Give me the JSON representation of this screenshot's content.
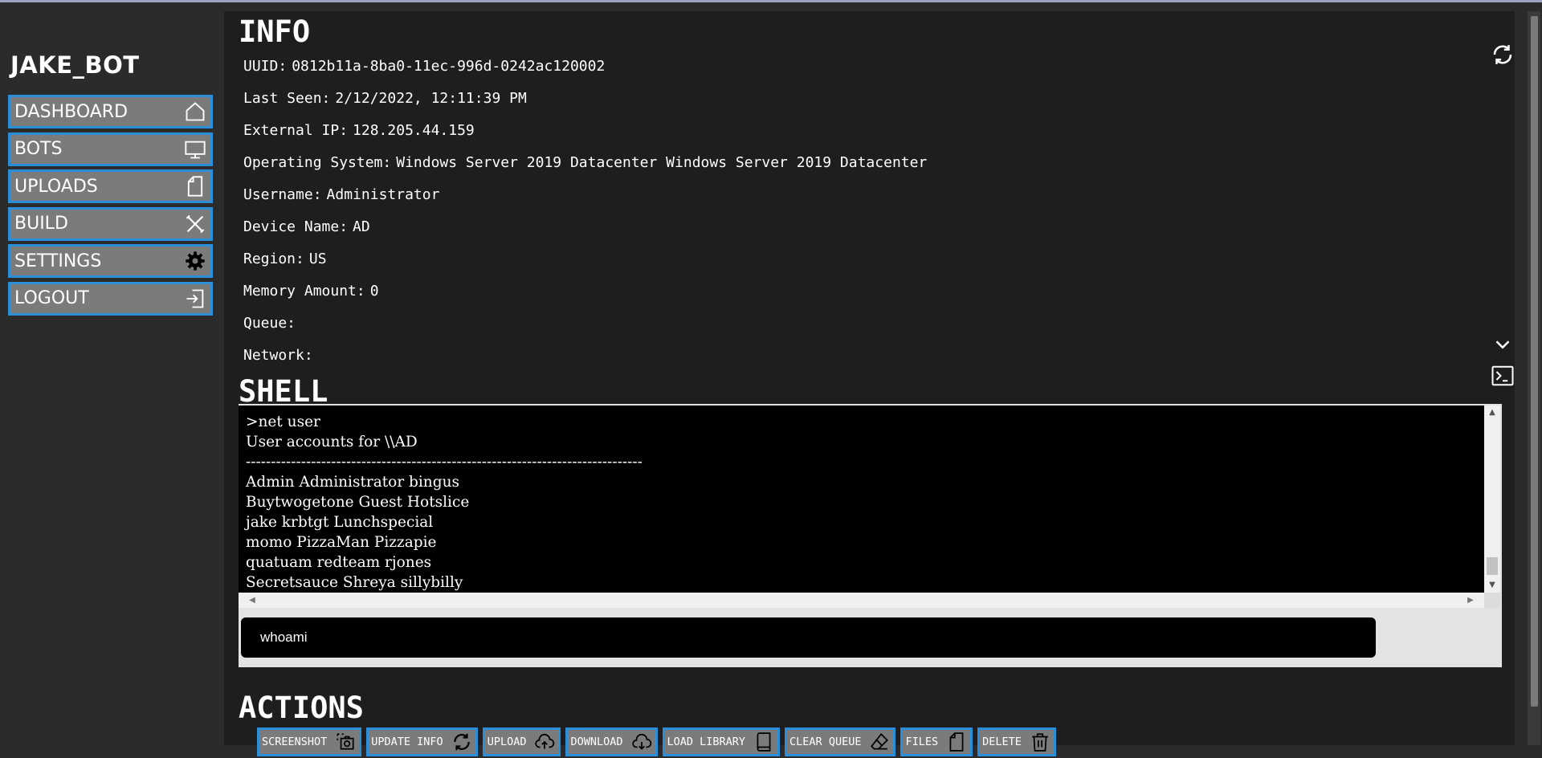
{
  "sidebar": {
    "brand": "JAKE_BOT",
    "items": [
      {
        "label": "DASHBOARD",
        "icon": "home-icon"
      },
      {
        "label": "BOTS",
        "icon": "monitor-icon"
      },
      {
        "label": "UPLOADS",
        "icon": "file-icon"
      },
      {
        "label": "BUILD",
        "icon": "tools-icon"
      },
      {
        "label": "SETTINGS",
        "icon": "gear-icon"
      },
      {
        "label": "LOGOUT",
        "icon": "logout-icon"
      }
    ]
  },
  "info": {
    "title": "INFO",
    "rows": [
      {
        "key": "UUID:",
        "value": "0812b11a-8ba0-11ec-996d-0242ac120002"
      },
      {
        "key": "Last Seen:",
        "value": "2/12/2022, 12:11:39 PM"
      },
      {
        "key": "External IP:",
        "value": "128.205.44.159"
      },
      {
        "key": "Operating System:",
        "value": "Windows Server 2019 Datacenter Windows Server 2019 Datacenter"
      },
      {
        "key": "Username:",
        "value": "Administrator"
      },
      {
        "key": "Device Name:",
        "value": "AD"
      },
      {
        "key": "Region:",
        "value": "US"
      },
      {
        "key": "Memory Amount:",
        "value": "0"
      },
      {
        "key": "Queue:",
        "value": ""
      },
      {
        "key": "Network:",
        "value": ""
      }
    ]
  },
  "shell": {
    "title": "SHELL",
    "lines": [
      ">net user",
      "User accounts for \\\\AD",
      "-------------------------------------------------------------------------------",
      "Admin Administrator bingus",
      "Buytwogetone Guest Hotslice",
      "jake krbtgt Lunchspecial",
      "momo PizzaMan Pizzapie",
      "quatuam redteam rjones",
      "Secretsauce Shreya sillybilly"
    ],
    "input_value": "whoami"
  },
  "actions": {
    "title": "ACTIONS",
    "buttons": [
      {
        "label": "SCREENSHOT",
        "icon": "screenshot-icon"
      },
      {
        "label": "UPDATE INFO",
        "icon": "refresh-icon"
      },
      {
        "label": "UPLOAD",
        "icon": "cloud-upload-icon"
      },
      {
        "label": "DOWNLOAD",
        "icon": "cloud-download-icon"
      },
      {
        "label": "LOAD LIBRARY",
        "icon": "book-icon"
      },
      {
        "label": "CLEAR QUEUE",
        "icon": "eraser-icon"
      },
      {
        "label": "FILES",
        "icon": "file-icon"
      },
      {
        "label": "DELETE",
        "icon": "trash-icon"
      }
    ]
  },
  "colors": {
    "accent_border": "#2a8ed8",
    "button_bg": "#7b7b7b",
    "panel_bg": "#1e1e1e",
    "page_bg": "#2b2b2b"
  }
}
